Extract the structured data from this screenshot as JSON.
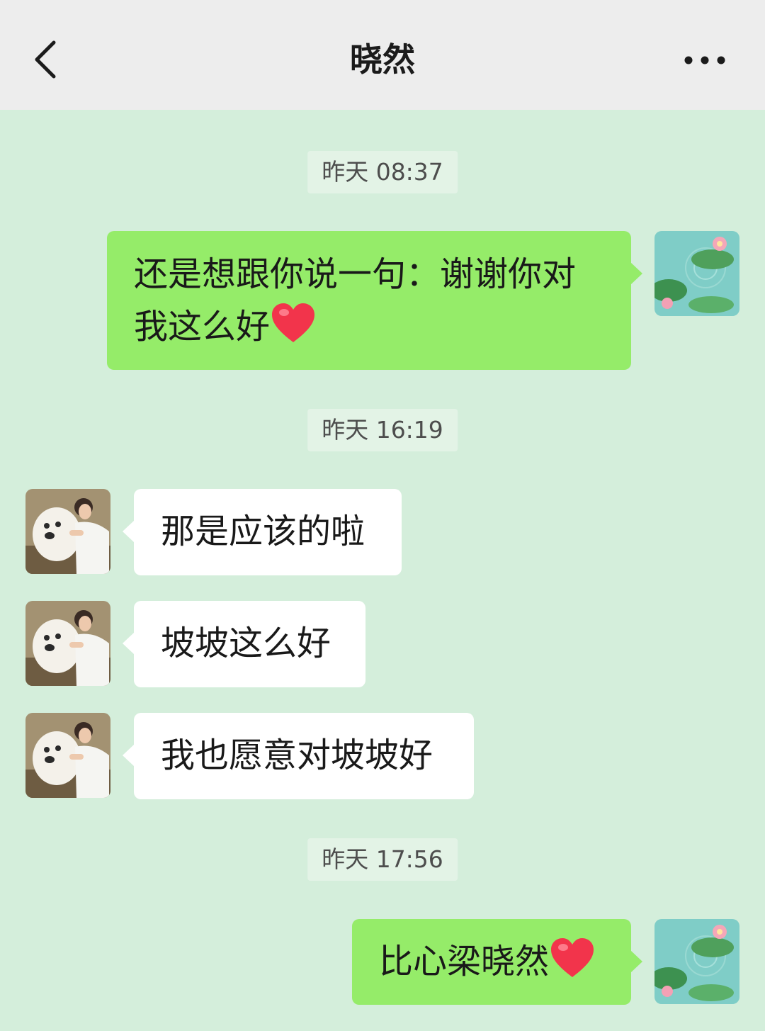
{
  "header": {
    "title": "晓然",
    "back_icon": "chevron-left-icon",
    "more_icon": "ellipsis-icon"
  },
  "messages": [
    {
      "type": "timestamp",
      "text": "昨天 08:37"
    },
    {
      "type": "outgoing",
      "text": "还是想跟你说一句：谢谢你对我这么好",
      "emoji": "heart-icon"
    },
    {
      "type": "timestamp",
      "text": "昨天 16:19"
    },
    {
      "type": "incoming",
      "text": "那是应该的啦"
    },
    {
      "type": "incoming",
      "text": "坡坡这么好"
    },
    {
      "type": "incoming",
      "text": "我也愿意对坡坡好"
    },
    {
      "type": "timestamp",
      "text": "昨天 17:56"
    },
    {
      "type": "outgoing",
      "text": "比心梁晓然",
      "emoji": "heart-icon"
    }
  ],
  "colors": {
    "background": "#d4eedb",
    "nav_bar": "#ededed",
    "outgoing_bubble": "#95ec69",
    "incoming_bubble": "#ffffff",
    "heart": "#f2344b"
  }
}
